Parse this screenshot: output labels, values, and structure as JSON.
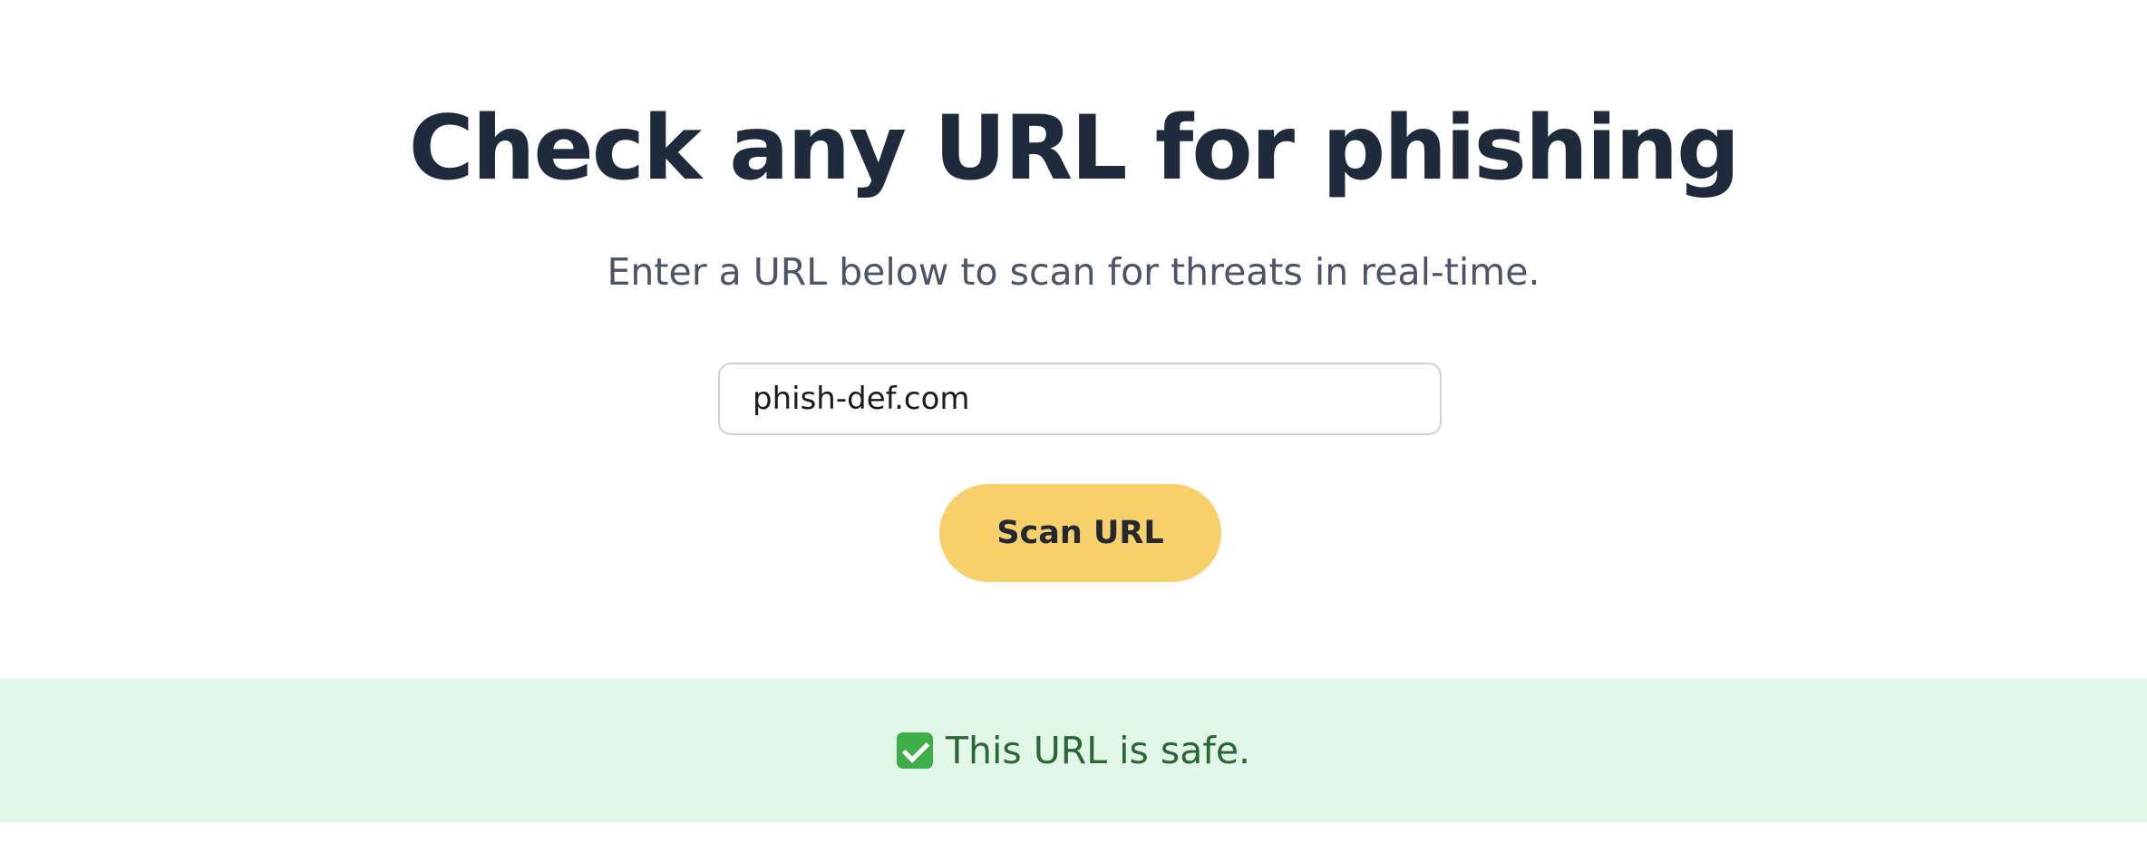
{
  "hero": {
    "title": "Check any URL for phishing",
    "subtitle": "Enter a URL below to scan for threats in real-time."
  },
  "search": {
    "value": "phish-def.com",
    "placeholder": ""
  },
  "actions": {
    "scan_label": "Scan URL"
  },
  "result": {
    "icon": "check-mark-icon",
    "text": "This URL is safe.",
    "status": "safe"
  },
  "colors": {
    "title": "#1f2a3d",
    "subtitle": "#4b5567",
    "button": "#f7d06c",
    "result_background": "#e1f8e8",
    "result_text": "#2a6637",
    "check_icon": "#3fae49"
  }
}
